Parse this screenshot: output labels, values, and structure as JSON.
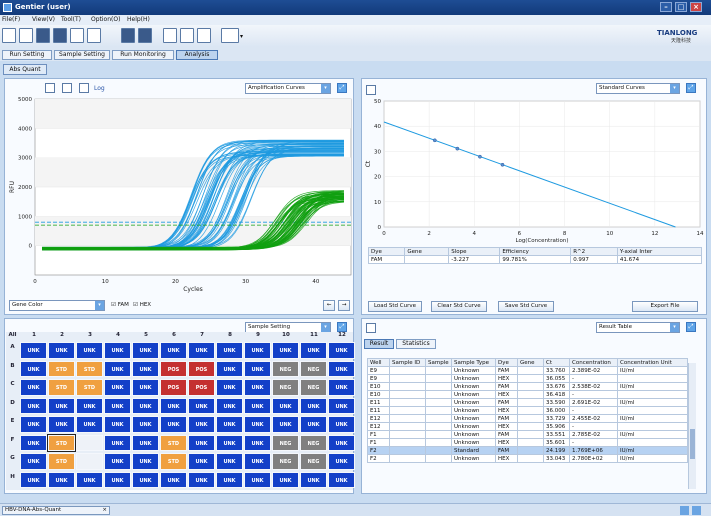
{
  "window": {
    "title": "Gentier (user)"
  },
  "menu": [
    "File(F)",
    "View(V)",
    "Tool(T)",
    "Option(O)",
    "Help(H)"
  ],
  "logo": {
    "text": "TIANLONG",
    "sub": "天隆科技"
  },
  "tabs": [
    "Run Setting",
    "Sample Setting",
    "Run Monitoring",
    "Analysis"
  ],
  "subtab": "Abs Quant",
  "amp": {
    "log_label": "Log",
    "combo": "Amplification Curves",
    "ylabel": "RFU",
    "xlabel": "Cycles",
    "gene_combo": "Gene Color",
    "checks": [
      "FAM",
      "HEX"
    ]
  },
  "std": {
    "combo": "Standard Curves",
    "ylabel": "Ct",
    "xlabel": "Log(Concentration)",
    "table_headers": [
      "Dye",
      "Gene",
      "Slope",
      "Efficiency",
      "R^2",
      "Y-axial Inter"
    ],
    "table_row": [
      "FAM",
      "",
      "-3.227",
      "99.781%",
      "0.997",
      "41.674"
    ],
    "buttons": [
      "Load Std Curve",
      "Clear Std Curve",
      "Save Std Curve",
      "Export File"
    ]
  },
  "plate": {
    "combo": "Sample Setting",
    "corner": "All",
    "cols": [
      "1",
      "2",
      "3",
      "4",
      "5",
      "6",
      "7",
      "8",
      "9",
      "10",
      "11",
      "12"
    ],
    "rows": [
      "A",
      "B",
      "C",
      "D",
      "E",
      "F",
      "G",
      "H"
    ],
    "grid": [
      [
        "UNK",
        "UNK",
        "UNK",
        "UNK",
        "UNK",
        "UNK",
        "UNK",
        "UNK",
        "UNK",
        "UNK",
        "UNK",
        "UNK"
      ],
      [
        "UNK",
        "STD",
        "STD",
        "UNK",
        "UNK",
        "POS",
        "POS",
        "UNK",
        "UNK",
        "NEG",
        "NEG",
        "UNK"
      ],
      [
        "UNK",
        "STD",
        "STD",
        "UNK",
        "UNK",
        "POS",
        "POS",
        "UNK",
        "UNK",
        "NEG",
        "NEG",
        "UNK"
      ],
      [
        "UNK",
        "UNK",
        "UNK",
        "UNK",
        "UNK",
        "UNK",
        "UNK",
        "UNK",
        "UNK",
        "UNK",
        "UNK",
        "UNK"
      ],
      [
        "UNK",
        "UNK",
        "UNK",
        "UNK",
        "UNK",
        "UNK",
        "UNK",
        "UNK",
        "UNK",
        "UNK",
        "UNK",
        "UNK"
      ],
      [
        "UNK",
        "STD",
        "",
        "UNK",
        "UNK",
        "STD",
        "UNK",
        "UNK",
        "UNK",
        "NEG",
        "NEG",
        "UNK"
      ],
      [
        "UNK",
        "STD",
        "",
        "UNK",
        "UNK",
        "STD",
        "UNK",
        "UNK",
        "UNK",
        "NEG",
        "NEG",
        "UNK"
      ],
      [
        "UNK",
        "UNK",
        "UNK",
        "UNK",
        "UNK",
        "UNK",
        "UNK",
        "UNK",
        "UNK",
        "UNK",
        "UNK",
        "UNK"
      ]
    ],
    "colors": {
      "UNK": "#1340c8",
      "STD": "#f0a040",
      "POS": "#c43030",
      "NEG": "#808080",
      "": "#eef2f8"
    }
  },
  "result": {
    "combo": "Result Table",
    "tabs": [
      "Result",
      "Statistics"
    ],
    "headers": [
      "Well",
      "Sample ID",
      "Sample",
      "Sample Type",
      "Dye",
      "Gene",
      "Ct",
      "Concentration",
      "Concentration Unit"
    ],
    "rows": [
      [
        "E9",
        "",
        "",
        "Unknown",
        "FAM",
        "",
        "33.760",
        "2.389E-02",
        "IU/ml"
      ],
      [
        "E9",
        "",
        "",
        "Unknown",
        "HEX",
        "",
        "36.055",
        "-",
        ""
      ],
      [
        "E10",
        "",
        "",
        "Unknown",
        "FAM",
        "",
        "33.676",
        "2.538E-02",
        "IU/ml"
      ],
      [
        "E10",
        "",
        "",
        "Unknown",
        "HEX",
        "",
        "36.418",
        "-",
        ""
      ],
      [
        "E11",
        "",
        "",
        "Unknown",
        "FAM",
        "",
        "33.590",
        "2.691E-02",
        "IU/ml"
      ],
      [
        "E11",
        "",
        "",
        "Unknown",
        "HEX",
        "",
        "36.000",
        "-",
        ""
      ],
      [
        "E12",
        "",
        "",
        "Unknown",
        "FAM",
        "",
        "33.729",
        "2.455E-02",
        "IU/ml"
      ],
      [
        "E12",
        "",
        "",
        "Unknown",
        "HEX",
        "",
        "35.906",
        "-",
        ""
      ],
      [
        "F1",
        "",
        "",
        "Unknown",
        "FAM",
        "",
        "33.551",
        "2.785E-02",
        "IU/ml"
      ],
      [
        "F1",
        "",
        "",
        "Unknown",
        "HEX",
        "",
        "35.601",
        "-",
        ""
      ],
      [
        "F2",
        "",
        "",
        "Standard",
        "FAM",
        "",
        "24.199",
        "1.769E+06",
        "IU/ml"
      ],
      [
        "F2",
        "",
        "",
        "Unknown",
        "HEX",
        "",
        "33.043",
        "2.780E+02",
        "IU/ml"
      ]
    ]
  },
  "status": {
    "tab": "HBV-DNA-Abs-Quant"
  },
  "chart_data": [
    {
      "type": "line",
      "title": "",
      "xlabel": "Cycles",
      "ylabel": "RFU",
      "xlim": [
        0,
        45
      ],
      "ylim": [
        -1000,
        5000
      ],
      "xticks": [
        0,
        10,
        20,
        30,
        40
      ],
      "yticks": [
        0,
        1000,
        2000,
        3000,
        4000,
        5000
      ],
      "series": [
        {
          "name": "FAM",
          "color": "#1e9ae0",
          "count": 60,
          "ct_range": [
            19,
            28
          ],
          "plateau": [
            3000,
            3600
          ],
          "threshold": 800
        },
        {
          "name": "HEX",
          "color": "#10a010",
          "count": 60,
          "ct_range": [
            31,
            36
          ],
          "plateau": [
            1500,
            1900
          ],
          "threshold": 700
        }
      ]
    },
    {
      "type": "scatter",
      "title": "",
      "xlabel": "Log(Concentration)",
      "ylabel": "Ct",
      "xlim": [
        0,
        14
      ],
      "ylim": [
        0,
        50
      ],
      "xticks": [
        0,
        2,
        4,
        6,
        8,
        10,
        12,
        14
      ],
      "yticks": [
        0,
        10,
        20,
        30,
        40,
        50
      ],
      "points": [
        [
          2.25,
          34.4
        ],
        [
          3.25,
          31.1
        ],
        [
          4.25,
          27.9
        ],
        [
          5.25,
          24.7
        ]
      ],
      "fit": {
        "slope": -3.227,
        "intercept": 41.674
      }
    }
  ]
}
